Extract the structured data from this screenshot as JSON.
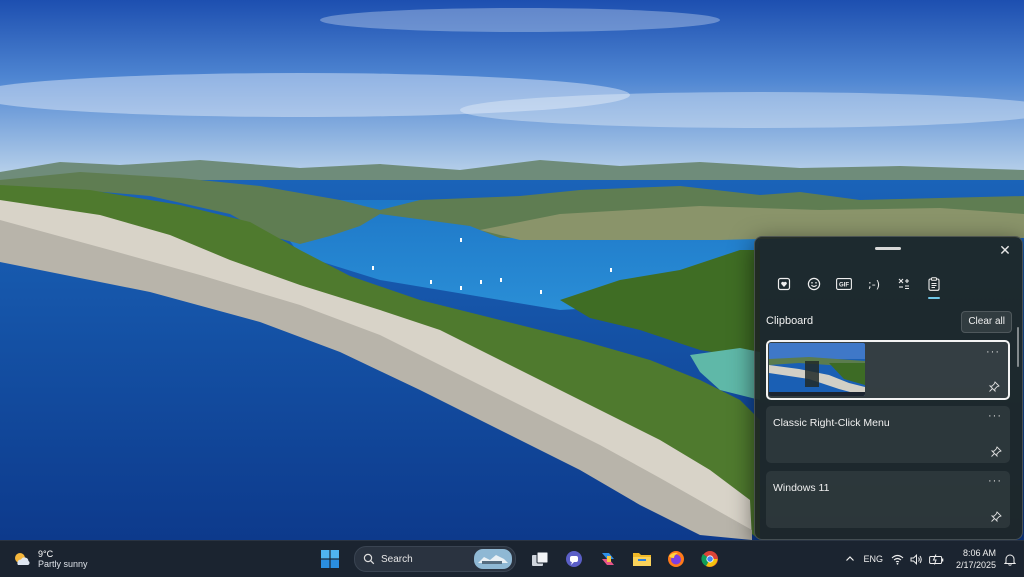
{
  "wallpaper": {
    "description_icon": "landscape-wallpaper"
  },
  "clipboard": {
    "title": "Clipboard",
    "clear_all_label": "Clear all",
    "close_glyph": "✕",
    "tabs": [
      {
        "icon": "sticker-heart-icon"
      },
      {
        "icon": "emoji-icon"
      },
      {
        "icon": "gif-icon",
        "label": "GIF"
      },
      {
        "icon": "kaomoji-icon",
        "label": ";-)"
      },
      {
        "icon": "symbols-icon"
      },
      {
        "icon": "clipboard-icon",
        "active": true
      }
    ],
    "items": [
      {
        "type": "image",
        "more": "···",
        "selected": true
      },
      {
        "type": "text",
        "text": "Classic Right-Click Menu",
        "more": "···"
      },
      {
        "type": "text",
        "text": "Windows 11",
        "more": "···"
      }
    ]
  },
  "taskbar": {
    "weather": {
      "temp": "9°C",
      "desc": "Partly sunny"
    },
    "search_label": "Search",
    "apps": [
      "start-icon",
      "task-view-icon",
      "teams-icon",
      "copilot-icon",
      "file-explorer-icon",
      "firefox-icon",
      "chrome-icon"
    ],
    "tray": {
      "lang": "ENG"
    },
    "clock": {
      "time": "8:06 AM",
      "date": "2/17/2025"
    }
  }
}
